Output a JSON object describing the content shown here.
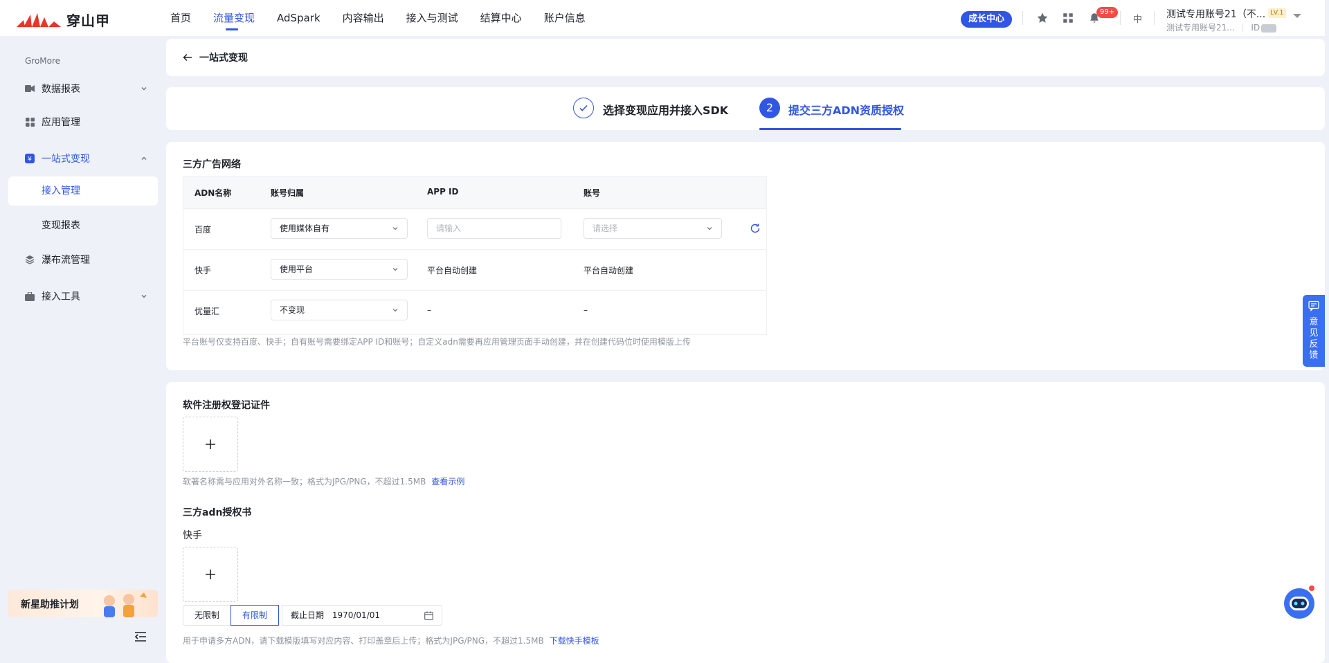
{
  "brand": {
    "logo_text": "穿山甲"
  },
  "nav": {
    "items": [
      {
        "label": "首页"
      },
      {
        "label": "流量变现",
        "active": true
      },
      {
        "label": "AdSpark"
      },
      {
        "label": "内容输出"
      },
      {
        "label": "接入与测试"
      },
      {
        "label": "结算中心"
      },
      {
        "label": "账户信息"
      }
    ]
  },
  "header": {
    "growth_center": "成长中心",
    "notifications_badge": "99+",
    "language": "中",
    "account_name": "测试专用账号21（不...",
    "level": "LV.1",
    "account_sub": "测试专用账号21...",
    "id_label": "ID"
  },
  "sidebar": {
    "group_label": "GroMore",
    "items": [
      {
        "label": "数据报表",
        "icon": "video-icon",
        "expandable": true
      },
      {
        "label": "应用管理",
        "icon": "grid-icon"
      },
      {
        "label": "一站式变现",
        "icon": "coin-icon",
        "expandable": true,
        "open": true
      },
      {
        "label": "瀑布流管理",
        "icon": "layers-icon"
      },
      {
        "label": "接入工具",
        "icon": "toolbox-icon",
        "expandable": true
      }
    ],
    "sub_items": [
      {
        "label": "接入管理",
        "active": true
      },
      {
        "label": "变现报表"
      }
    ],
    "promo": "新星助推计划"
  },
  "page": {
    "back_title": "一站式变现"
  },
  "steps": {
    "step1": {
      "label": "选择变现应用并接入SDK",
      "status": "done"
    },
    "step2": {
      "number": "2",
      "label": "提交三方ADN资质授权",
      "status": "active"
    }
  },
  "adn": {
    "section_title": "三方广告网络",
    "columns": [
      "ADN名称",
      "账号归属",
      "APP ID",
      "账号"
    ],
    "rows": [
      {
        "name": "百度",
        "ownership": "使用媒体自有",
        "app_id_placeholder": "请输入",
        "account_placeholder": "请选择"
      },
      {
        "name": "快手",
        "ownership": "使用平台",
        "app_id": "平台自动创建",
        "account": "平台自动创建"
      },
      {
        "name": "优量汇",
        "ownership": "不变现",
        "app_id": "–",
        "account": "–"
      }
    ],
    "hint": "平台账号仅支持百度、快手；自有账号需要绑定APP ID和账号；自定义adn需要再应用管理页面手动创建，并在创建代码位时使用模版上传"
  },
  "uploads": {
    "software_cert": {
      "title": "软件注册权登记证件",
      "hint": "软著名称需与应用对外名称一致；格式为JPG/PNG，不超过1.5MB",
      "link": "查看示例"
    },
    "adn_auth": {
      "title": "三方adn授权书",
      "sub_label": "快手",
      "options": [
        "无限制",
        "有限制"
      ],
      "selected": "有限制",
      "date_label": "截止日期",
      "date_value": "1970/01/01",
      "hint": "用于申请多方ADN，请下载模版填写对应内容、打印盖章后上传；格式为JPG/PNG，不超过1.5MB",
      "link": "下载快手模板"
    }
  },
  "floating": {
    "feedback": "意见反馈"
  },
  "colors": {
    "accent": "#3056e3",
    "badge": "#f54a45",
    "feedback_bg": "#3a6ff2"
  }
}
